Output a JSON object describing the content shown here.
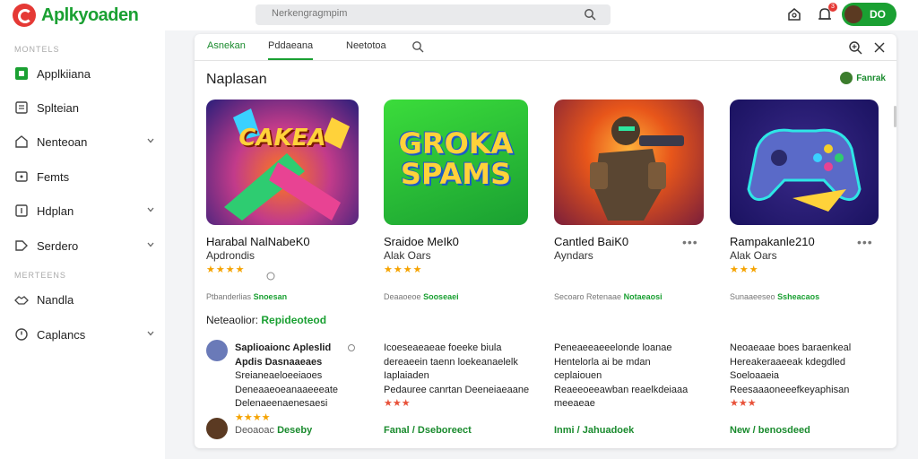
{
  "app": {
    "title": "Aplkyoaden"
  },
  "search": {
    "placeholder": "Nerkengragmpim"
  },
  "user": {
    "label": "DO",
    "notification_count": "3"
  },
  "sidebar": {
    "section1": "MONTELS",
    "section2": "MERTEENS",
    "items": [
      {
        "label": "Applkiiana",
        "icon": "app-icon"
      },
      {
        "label": "Splteian",
        "icon": "document-icon"
      },
      {
        "label": "Nenteoan",
        "icon": "home-icon"
      },
      {
        "label": "Femts",
        "icon": "folder-icon"
      },
      {
        "label": "Hdplan",
        "icon": "bookmark-icon"
      },
      {
        "label": "Serdero",
        "icon": "tag-icon"
      },
      {
        "label": "Nandla",
        "icon": "handshake-icon"
      },
      {
        "label": "Caplancs",
        "icon": "clock-icon"
      }
    ]
  },
  "tabs": [
    {
      "label": "Asnekan"
    },
    {
      "label": "Pddaeana"
    },
    {
      "label": "Neetotoa"
    }
  ],
  "panel": {
    "title": "Naplasan",
    "filter_label": "Fanrak"
  },
  "cards": [
    {
      "art_text": "CAKEA",
      "title": "Harabal NalNabeK0",
      "subtitle": "Apdrondis",
      "stars": "★★★★",
      "meta1": "Ptbanderlias",
      "meta2": "Snoesan"
    },
    {
      "art_text": "GROKA SPAMS",
      "title": "Sraidoe MeIk0",
      "subtitle": "Alak Oars",
      "stars": "★★★★",
      "meta1": "Deaaoeoe",
      "meta2": "Sooseaei"
    },
    {
      "art_text": "",
      "title": "Cantled BaiK0",
      "subtitle": "Ayndars",
      "stars": "",
      "meta1": "Secoaro Retenaae",
      "meta2": "Notaeaosi"
    },
    {
      "art_text": "",
      "title": "Rampakanle210",
      "subtitle": "Alak Oars",
      "stars": "★★★",
      "meta1": "Sunaaeeseo",
      "meta2": "Ssheacaos"
    }
  ],
  "reviews": {
    "heading": "Neteaolior:",
    "heading_highlight": "Repideoteod",
    "columns": [
      {
        "head": "Saplioaionc Apleslid",
        "lines": [
          "Apdis Dasnaaeaes",
          "Sreianeaeloeeiaoes",
          "Deneaaeoeanaaeeeate",
          "Delenaeenaenesaesi"
        ],
        "stars": "★★★★",
        "foot_prefix": "Deoaoac",
        "foot": "Deseby"
      },
      {
        "head": "Icoeseaeaeae foeeke biula",
        "lines": [
          "dereaeein taenn loekeanaelelk",
          "Iaplaiaden",
          "Pedauree canrtan Deeneiaeaane"
        ],
        "stars": "★★★",
        "foot_prefix": "",
        "foot": "Fanal / Dseboreect"
      },
      {
        "head": "Peneaeeaeeelonde loanae",
        "lines": [
          "Hentelorla ai be mdan",
          "ceplaiouen",
          "Reaeeoeeawban reaelkdeiaaa",
          "meeaeae"
        ],
        "stars": "",
        "foot_prefix": "",
        "foot": "Inmi / Jahuadoek"
      },
      {
        "head": "Neoaeaae boes baraenkeal",
        "lines": [
          "Hereakeraaeeak kdegdled",
          "Soeloaaeia",
          "Reesaaaoneeefkeyaphisan"
        ],
        "stars": "★★★",
        "foot_prefix": "",
        "foot": "New / benosdeed"
      }
    ]
  },
  "colors": {
    "accent": "#1aa032",
    "brand_red": "#e53935",
    "star": "#f5a300"
  }
}
